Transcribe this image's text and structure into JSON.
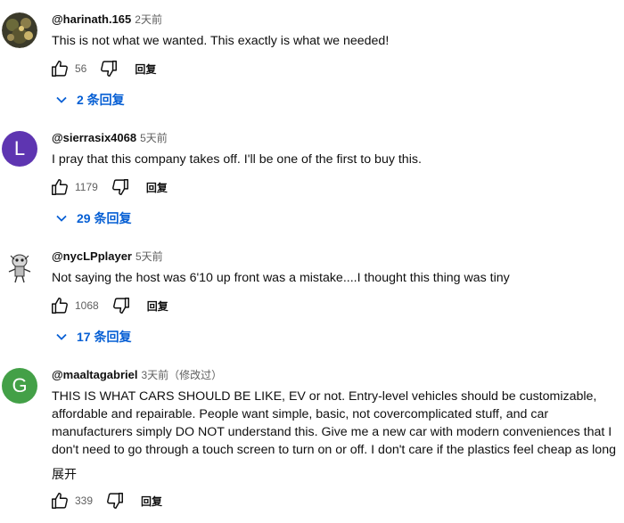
{
  "comments": [
    {
      "author": "@harinath.165",
      "time": "2天前",
      "text": [
        "This is not what we wanted. This exactly is what we needed!"
      ],
      "likes": "56",
      "reply_label": "回复",
      "replies_label": "2 条回复",
      "avatar_icon": "photo-avatar"
    },
    {
      "author": "@sierrasix4068",
      "time": "5天前",
      "text": [
        "I pray that this company takes off. I'll be one of the first to buy this."
      ],
      "likes": "1179",
      "reply_label": "回复",
      "replies_label": "29 条回复",
      "avatar_letter": "L",
      "avatar_color": "#5e35b1"
    },
    {
      "author": "@nycLPplayer",
      "time": "5天前",
      "text": [
        "Not saying the host was 6'10 up front was a mistake....I thought this thing was tiny"
      ],
      "likes": "1068",
      "reply_label": "回复",
      "replies_label": "17 条回复",
      "avatar_icon": "cartoon-avatar"
    },
    {
      "author": "@maaltagabriel",
      "time": "3天前（修改过）",
      "text": [
        "THIS IS WHAT CARS SHOULD BE LIKE, EV or not. Entry-level vehicles should be customizable,",
        "affordable and repairable. People want simple, basic, not covercomplicated stuff, and car",
        "manufacturers simply DO NOT understand this. Give me a new car with modern conveniences that I",
        "don't need to go through a touch screen to turn on or off. I don't care if the plastics feel cheap as long"
      ],
      "expand_label": "展开",
      "likes": "339",
      "reply_label": "回复",
      "avatar_letter": "G",
      "avatar_color": "#43a047"
    }
  ]
}
